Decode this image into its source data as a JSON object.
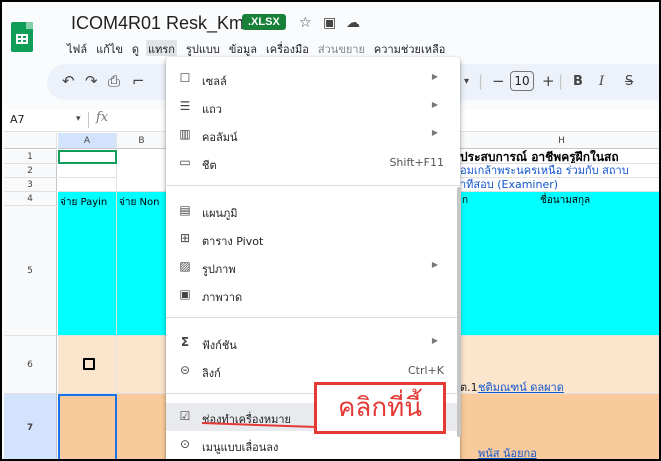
{
  "app": {
    "title": "ICOM4R01 Resk_Kmutnb",
    "badge": ".XLSX"
  },
  "menubar": {
    "items": [
      "ไฟล์",
      "แก้ไข",
      "ดู",
      "แทรก",
      "รูปแบบ",
      "ข้อมูล",
      "เครื่องมือ",
      "ส่วนขยาย",
      "ความช่วยเหลือ"
    ]
  },
  "toolbar": {
    "font_size": "10",
    "minus": "−",
    "plus": "+",
    "bold": "B",
    "italic": "I",
    "strike": "S"
  },
  "formula_bar": {
    "name_box": "A7",
    "fx": "fx"
  },
  "grid": {
    "columns": [
      "A",
      "B",
      "H"
    ],
    "rows": [
      "1",
      "2",
      "3",
      "4",
      "5",
      "6",
      "7"
    ],
    "cells": {
      "a4": "จ่าย Payin",
      "b4": "จ่าย Non",
      "h1": "ประสบการณ์ อาชีพครูฝึกในสถ",
      "h2": "อมเกล้าพระนครเหนือ ร่วมกับ สถาบ",
      "h3": "าที่สอบ (Examiner)",
      "h3_prefix": "ก",
      "h4": "ชื่อนามสกุล",
      "h6": "ชติมณฑน์ ดลผาด",
      "h6_prefix": "ต.1",
      "h7": "พนัส น้อยกอ"
    }
  },
  "insert_menu": {
    "items": [
      {
        "label": "เซลล์",
        "icon": "cell-icon",
        "arrow": true
      },
      {
        "label": "แถว",
        "icon": "row-icon",
        "arrow": true
      },
      {
        "label": "คอลัมน์",
        "icon": "column-icon",
        "arrow": true
      },
      {
        "label": "ชีต",
        "icon": "sheet-icon",
        "shortcut": "Shift+F11"
      },
      {
        "label": "แผนภูมิ",
        "icon": "chart-icon"
      },
      {
        "label": "ตาราง Pivot",
        "icon": "pivot-icon"
      },
      {
        "label": "รูปภาพ",
        "icon": "image-icon",
        "arrow": true
      },
      {
        "label": "ภาพวาด",
        "icon": "drawing-icon"
      },
      {
        "label": "ฟังก์ชัน",
        "icon": "sigma-icon",
        "arrow": true
      },
      {
        "label": "ลิงก์",
        "icon": "link-icon",
        "shortcut": "Ctrl+K"
      },
      {
        "label": "ช่องทำเครื่องหมาย",
        "icon": "checkbox-icon"
      },
      {
        "label": "เมนูแบบเลื่อนลง",
        "icon": "dropdown-icon"
      }
    ]
  },
  "annotation": {
    "text": "คลิกที่นี้",
    "color": "#e53935"
  },
  "colors": {
    "cyan": "#00ffff",
    "peach": "#fce5cd",
    "orange": "#f9cb9c",
    "accent": "#1a73e8",
    "xlsx_badge": "#188038"
  }
}
